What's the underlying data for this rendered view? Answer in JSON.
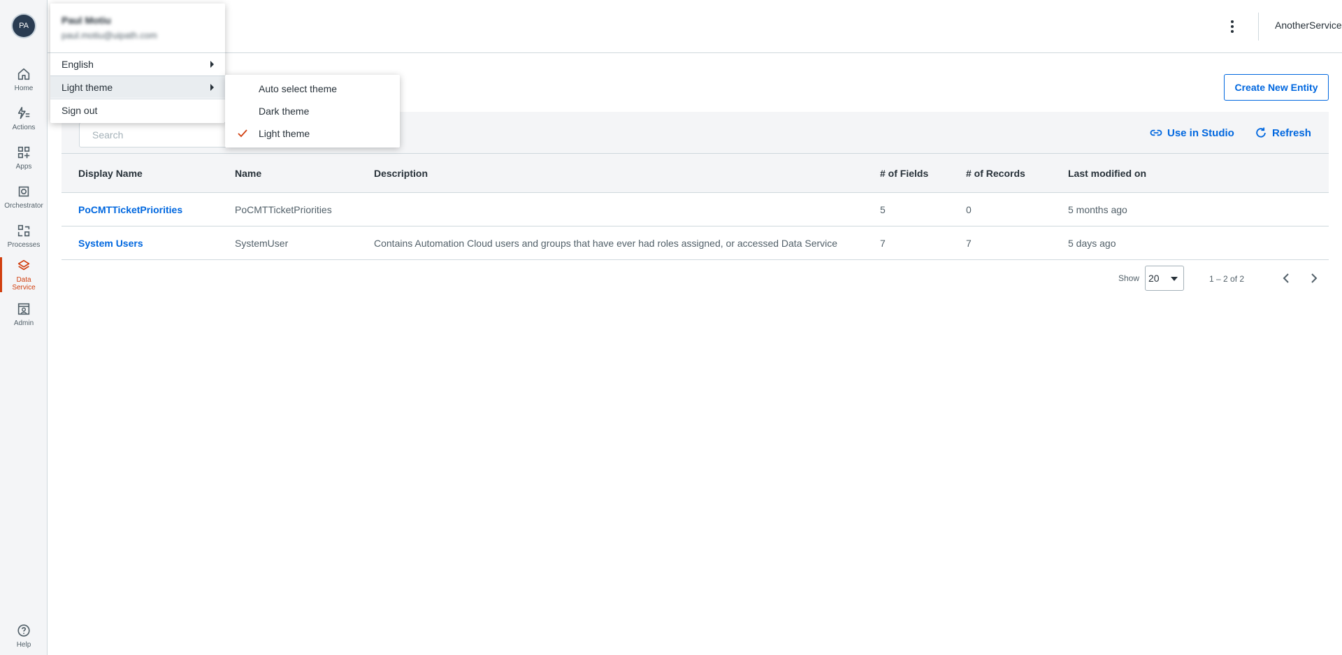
{
  "sidebar": {
    "avatar_initials": "PA",
    "items": [
      {
        "label": "Home",
        "icon": "home-icon"
      },
      {
        "label": "Actions",
        "icon": "actions-icon"
      },
      {
        "label": "Apps",
        "icon": "apps-icon"
      },
      {
        "label": "Orchestrator",
        "icon": "orchestrator-icon"
      },
      {
        "label": "Processes",
        "icon": "processes-icon"
      },
      {
        "label_line1": "Data",
        "label_line2": "Service",
        "icon": "data-service-icon",
        "active": true
      },
      {
        "label": "Admin",
        "icon": "admin-icon"
      }
    ],
    "help_label": "Help"
  },
  "header": {
    "service_name": "AnotherService"
  },
  "main": {
    "create_button_label": "Create New Entity",
    "search_placeholder": "Search",
    "use_in_studio_label": "Use in Studio",
    "refresh_label": "Refresh",
    "table": {
      "columns": [
        "Display Name",
        "Name",
        "Description",
        "# of Fields",
        "# of Records",
        "Last modified on"
      ],
      "rows": [
        {
          "display_name": "PoCMTTicketPriorities",
          "name": "PoCMTTicketPriorities",
          "description": "",
          "fields": "5",
          "records": "0",
          "modified": "5 months ago"
        },
        {
          "display_name": "System Users",
          "name": "SystemUser",
          "description": "Contains Automation Cloud users and groups that have ever had roles assigned, or accessed Data Service",
          "fields": "7",
          "records": "7",
          "modified": "5 days ago"
        }
      ]
    },
    "pagination": {
      "show_label": "Show",
      "page_size": "20",
      "range": "1 – 2 of 2"
    }
  },
  "user_menu": {
    "name": "Paul Motiu",
    "email": "paul.motiu@uipath.com",
    "items": {
      "language": "English",
      "theme": "Light theme",
      "sign_out": "Sign out"
    }
  },
  "theme_menu": {
    "options": [
      "Auto select theme",
      "Dark theme",
      "Light theme"
    ],
    "selected": "Light theme"
  },
  "colors": {
    "accent": "#0067df",
    "active_nav": "#d13f0f",
    "avatar_bg": "#2a3c52"
  }
}
